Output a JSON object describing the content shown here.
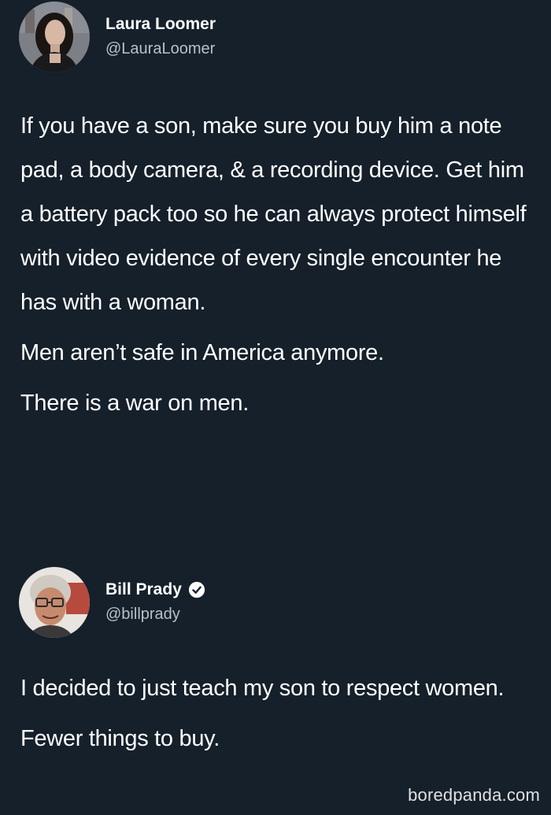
{
  "tweets": [
    {
      "display_name": "Laura Loomer",
      "handle": "@LauraLoomer",
      "verified": false,
      "paragraphs": [
        "If you have a son, make sure you buy him a note pad, a body camera, & a recording device. Get him a battery pack too so he can always protect himself with video evidence of every single encounter he has with a woman.",
        "Men aren’t safe in America anymore.",
        "There is a war on men."
      ]
    },
    {
      "display_name": "Bill Prady",
      "handle": "@billprady",
      "verified": true,
      "paragraphs": [
        "I decided to just teach my son to respect women.",
        "Fewer things to buy."
      ]
    }
  ],
  "watermark": "boredpanda.com",
  "colors": {
    "background": "#15202b",
    "text": "#ffffff",
    "handle": "#b8c0c8"
  },
  "icons": {
    "verified": "verified-badge-icon"
  }
}
